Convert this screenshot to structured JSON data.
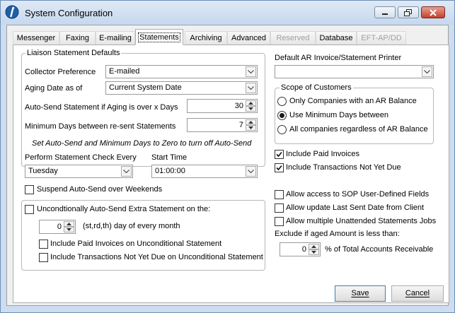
{
  "window": {
    "title": "System Configuration"
  },
  "tabs": [
    {
      "label": "Messenger",
      "state": "normal"
    },
    {
      "label": "Faxing",
      "state": "normal"
    },
    {
      "label": "E-mailing",
      "state": "normal"
    },
    {
      "label": "Statements",
      "state": "active"
    },
    {
      "label": "Archiving",
      "state": "normal"
    },
    {
      "label": "Advanced",
      "state": "normal"
    },
    {
      "label": "Reserved",
      "state": "disabled"
    },
    {
      "label": "Database",
      "state": "normal"
    },
    {
      "label": "EFT-AP/DD",
      "state": "disabled"
    }
  ],
  "liaison": {
    "legend": "Liaison Statement Defaults",
    "collector_label": "Collector Preference",
    "collector_value": "E-mailed",
    "aging_label": "Aging Date as of",
    "aging_value": "Current System Date",
    "autosend_label": "Auto-Send Statement if Aging is over x Days",
    "autosend_value": "30",
    "mindays_label": "Minimum Days between re-sent Statements",
    "mindays_value": "7",
    "note": "Set Auto-Send and Minimum Days to Zero to turn off Auto-Send"
  },
  "check": {
    "perform_label": "Perform Statement Check Every",
    "perform_value": "Tuesday",
    "start_label": "Start Time",
    "start_value": "01:00:00",
    "suspend_label": "Suspend Auto-Send over Weekends",
    "suspend_checked": false
  },
  "extra": {
    "uncond_label": "Uncondtionally Auto-Send Extra Statement on the:",
    "uncond_checked": false,
    "day_value": "0",
    "day_suffix": "(st,rd,th) day of every month",
    "paid_label": "Include Paid Invoices on Unconditional Statement",
    "paid_checked": false,
    "notdue_label": "Include Transactions Not Yet Due on Unconditional Statement",
    "notdue_checked": false
  },
  "printer": {
    "label": "Default AR Invoice/Statement Printer",
    "value": ""
  },
  "scope": {
    "legend": "Scope of Customers",
    "options": [
      {
        "label": "Only Companies with an AR Balance",
        "selected": false
      },
      {
        "label": "Use Minimum Days between",
        "selected": true
      },
      {
        "label": "All companies regardless of AR Balance",
        "selected": false
      }
    ]
  },
  "right_checks": {
    "paid_label": "Include Paid Invoices",
    "paid_checked": true,
    "notdue_label": "Include Transactions Not Yet Due",
    "notdue_checked": true,
    "sop_label": "Allow access to SOP User-Defined Fields",
    "sop_checked": false,
    "lastsent_label": "Allow update Last Sent Date from Client",
    "lastsent_checked": false,
    "multi_label": "Allow multiple Unattended Statements Jobs",
    "multi_checked": false
  },
  "exclude": {
    "label": "Exclude if aged Amount is less than:",
    "value": "0",
    "suffix": "% of Total Accounts Receivable"
  },
  "buttons": {
    "save_label": "Save",
    "cancel_label": "Cancel"
  },
  "colors": {
    "title_bar": "#cddcee",
    "panel": "#ffffff",
    "dialog": "#f0f0f0",
    "default_button_border": "#3c7fb1"
  }
}
